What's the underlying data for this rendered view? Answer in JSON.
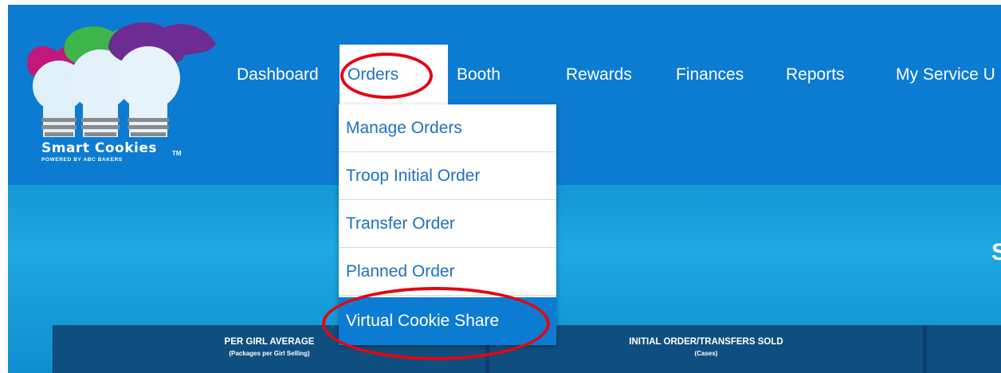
{
  "brand": {
    "name": "Smart Cookies",
    "trademark": "TM",
    "tagline": "POWERED BY ABC BAKERS"
  },
  "nav": {
    "items": [
      {
        "label": "Dashboard"
      },
      {
        "label": "Orders"
      },
      {
        "label": "Booth"
      },
      {
        "label": "Rewards"
      },
      {
        "label": "Finances"
      },
      {
        "label": "Reports"
      },
      {
        "label": "My Service U"
      }
    ]
  },
  "orders_menu": {
    "items": [
      {
        "label": "Manage Orders"
      },
      {
        "label": "Troop Initial Order"
      },
      {
        "label": "Transfer Order"
      },
      {
        "label": "Planned Order"
      },
      {
        "label": "Virtual Cookie Share"
      }
    ],
    "highlighted": "Virtual Cookie Share"
  },
  "hero": {
    "partial_heading": "S"
  },
  "stats": [
    {
      "title": "PER GIRL AVERAGE",
      "subtitle": "(Packages per Girl Selling)"
    },
    {
      "title": "INITIAL ORDER/TRANSFERS SOLD",
      "subtitle": "(Cases)"
    }
  ],
  "colors": {
    "header_bg": "#0c7bd2",
    "link_blue": "#1f70c1",
    "annotation_red": "#e30613",
    "stats_bg": "#0f4f7f"
  }
}
